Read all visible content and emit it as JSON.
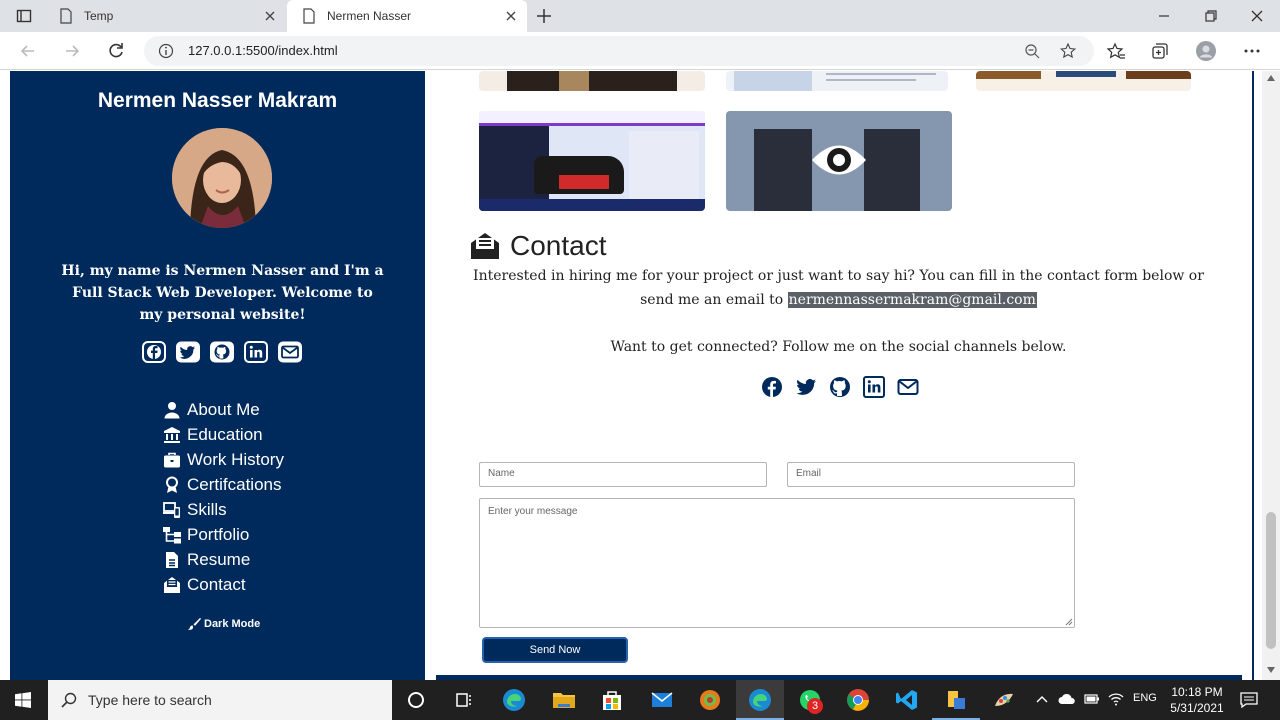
{
  "browser": {
    "tabs": [
      {
        "title": "Temp"
      },
      {
        "title": "Nermen Nasser"
      }
    ],
    "url": "127.0.0.1:5500/index.html"
  },
  "sidebar": {
    "name": "Nermen Nasser Makram",
    "intro": "Hi, my name is Nermen Nasser and I'm a Full Stack Web Developer. Welcome to my personal website!",
    "menu": [
      {
        "label": "About Me",
        "icon": "user-icon"
      },
      {
        "label": "Education",
        "icon": "university-icon"
      },
      {
        "label": "Work History",
        "icon": "briefcase-icon"
      },
      {
        "label": "Certifcations",
        "icon": "award-icon"
      },
      {
        "label": "Skills",
        "icon": "laptop-icon"
      },
      {
        "label": "Portfolio",
        "icon": "sitemap-icon"
      },
      {
        "label": "Resume",
        "icon": "file-icon"
      },
      {
        "label": "Contact",
        "icon": "envelope-open-icon"
      }
    ],
    "dark_mode": "Dark Mode"
  },
  "contact": {
    "title": "Contact",
    "text": "Interested in hiring me for your project or just want to say hi? You can fill in the contact form below or send me an email to",
    "email": "nermennassermakram@gmail.com",
    "follow": "Want to get connected? Follow me on the social channels below.",
    "form": {
      "name_placeholder": "Name",
      "email_placeholder": "Email",
      "message_placeholder": "Enter your message",
      "send_label": "Send Now"
    }
  },
  "taskbar": {
    "search_placeholder": "Type here to search",
    "lang": "ENG",
    "time": "10:18 PM",
    "date": "5/31/2021",
    "whatsapp_badge": "3"
  },
  "colors": {
    "sidebar_bg": "#002a5b",
    "email_highlight": "#5a6066"
  }
}
